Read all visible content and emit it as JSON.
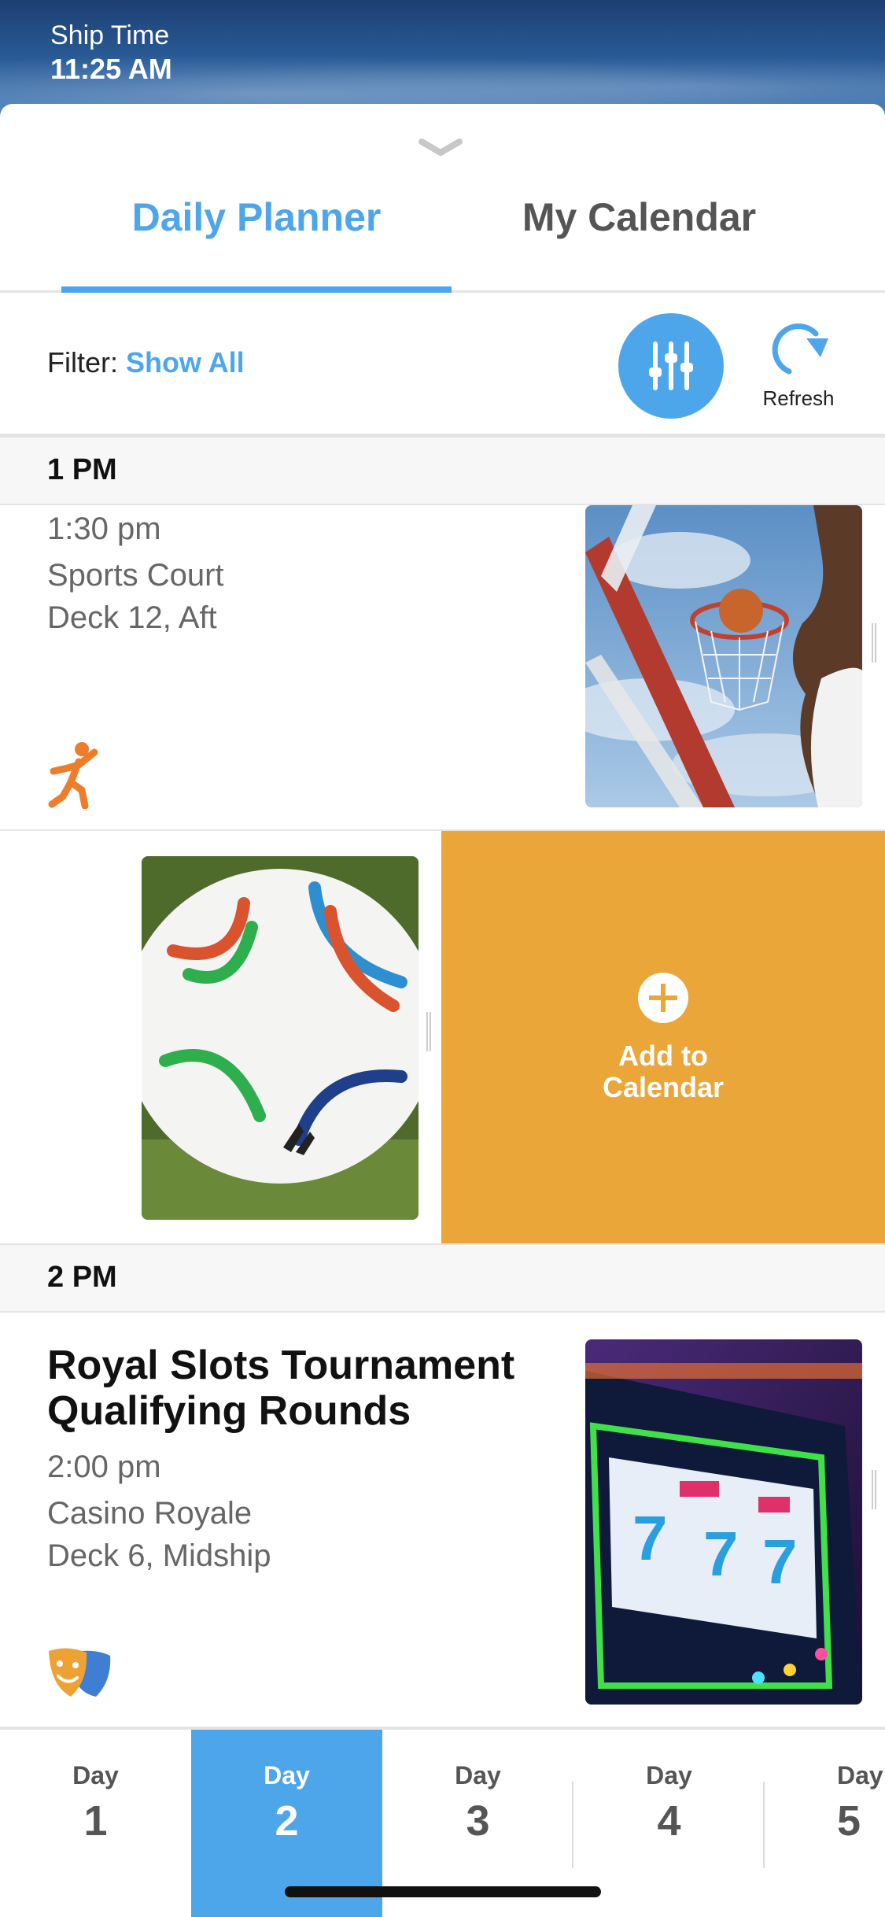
{
  "status": {
    "ship_time_label": "Ship Time",
    "ship_time_value": "11:25 AM"
  },
  "tabs": [
    {
      "label": "Daily Planner",
      "active": true
    },
    {
      "label": "My Calendar",
      "active": false
    }
  ],
  "filter": {
    "label": "Filter:",
    "value": "Show All",
    "refresh_label": "Refresh"
  },
  "sections": [
    {
      "header": "1 PM",
      "event": {
        "time": "1:30 pm",
        "venue": "Sports Court",
        "deck": "Deck 12, Aft",
        "category_icon": "activity-icon"
      },
      "swipe_action": {
        "label_line1": "Add to",
        "label_line2": "Calendar"
      }
    },
    {
      "header": "2 PM",
      "event": {
        "title": "Royal Slots Tournament Qualifying Rounds",
        "time": "2:00 pm",
        "venue": "Casino Royale",
        "deck": "Deck 6, Midship",
        "category_icon": "theater-masks-icon"
      }
    }
  ],
  "days": [
    {
      "label": "Day",
      "number": "1",
      "active": false
    },
    {
      "label": "Day",
      "number": "2",
      "active": true
    },
    {
      "label": "Day",
      "number": "3",
      "active": false
    },
    {
      "label": "Day",
      "number": "4",
      "active": false
    },
    {
      "label": "Day",
      "number": "5",
      "active": false
    }
  ],
  "colors": {
    "accent": "#4ea6ea",
    "action_orange": "#eba63a"
  }
}
